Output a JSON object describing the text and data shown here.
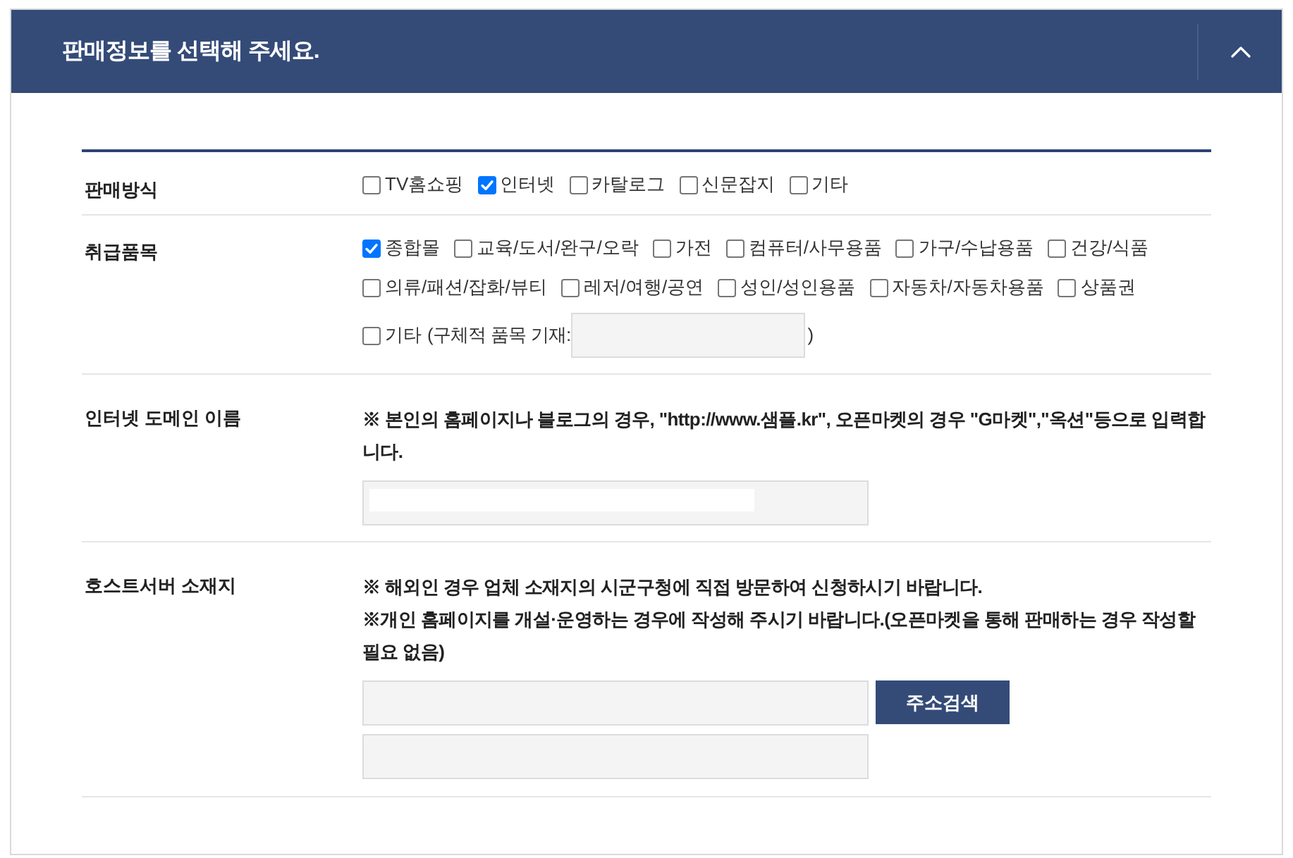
{
  "header": {
    "title": "판매정보를 선택해 주세요.",
    "expanded": true
  },
  "rows": [
    {
      "kind": "checkboxes",
      "label": "판매방식",
      "options": [
        {
          "label": "TV홈쇼핑",
          "checked": false
        },
        {
          "label": "인터넷",
          "checked": true
        },
        {
          "label": "카탈로그",
          "checked": false
        },
        {
          "label": "신문잡지",
          "checked": false
        },
        {
          "label": "기타",
          "checked": false
        }
      ]
    },
    {
      "kind": "checkboxes",
      "label": "취급품목",
      "options": [
        {
          "label": "종합몰",
          "checked": true
        },
        {
          "label": "교육/도서/완구/오락",
          "checked": false
        },
        {
          "label": "가전",
          "checked": false
        },
        {
          "label": "컴퓨터/사무용품",
          "checked": false
        },
        {
          "label": "가구/수납용품",
          "checked": false
        },
        {
          "label": "건강/식품",
          "checked": false
        },
        {
          "label": "의류/패션/잡화/뷰티",
          "checked": false
        },
        {
          "label": "레저/여행/공연",
          "checked": false
        },
        {
          "label": "성인/성인용품",
          "checked": false
        },
        {
          "label": "자동차/자동차용품",
          "checked": false
        },
        {
          "label": "상품권",
          "checked": false
        }
      ],
      "other": {
        "label": "기타",
        "checked": false,
        "prefix": "(구체적 품목 기재:",
        "suffix": ")"
      }
    },
    {
      "kind": "domain",
      "label": "인터넷 도메인 이름",
      "notes": [
        "※ 본인의 홈페이지나 블로그의 경우, \"http://www.샘플.kr\", 오픈마켓의 경우 \"G마켓\",\"옥션\"등으로 입력합니다."
      ]
    },
    {
      "kind": "address",
      "label": "호스트서버 소재지",
      "notes": [
        "※ 해외인 경우 업체 소재지의 시군구청에 직접 방문하여 신청하시기 바랍니다.",
        "※개인 홈페이지를 개설·운영하는 경우에 작성해 주시기 바랍니다.(오픈마켓을 통해 판매하는 경우 작성할 필요 없음)"
      ],
      "button": "주소검색"
    }
  ]
}
